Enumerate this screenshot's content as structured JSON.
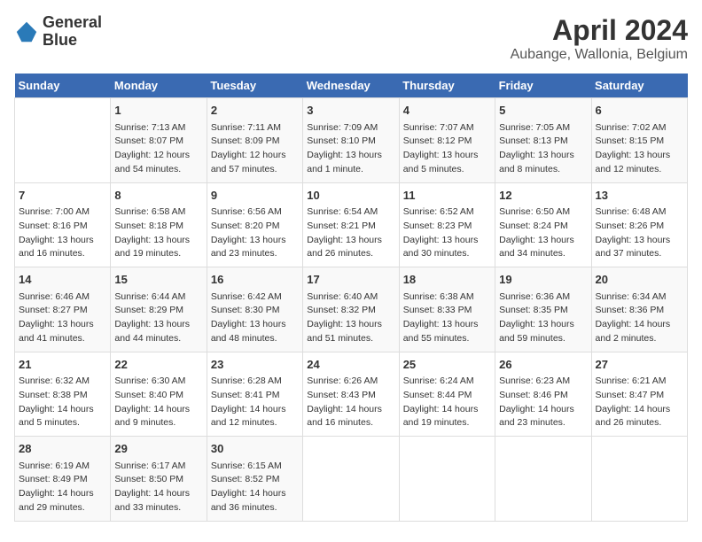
{
  "header": {
    "logo_line1": "General",
    "logo_line2": "Blue",
    "title": "April 2024",
    "subtitle": "Aubange, Wallonia, Belgium"
  },
  "columns": [
    "Sunday",
    "Monday",
    "Tuesday",
    "Wednesday",
    "Thursday",
    "Friday",
    "Saturday"
  ],
  "weeks": [
    [
      {
        "day": "",
        "info": ""
      },
      {
        "day": "1",
        "info": "Sunrise: 7:13 AM\nSunset: 8:07 PM\nDaylight: 12 hours\nand 54 minutes."
      },
      {
        "day": "2",
        "info": "Sunrise: 7:11 AM\nSunset: 8:09 PM\nDaylight: 12 hours\nand 57 minutes."
      },
      {
        "day": "3",
        "info": "Sunrise: 7:09 AM\nSunset: 8:10 PM\nDaylight: 13 hours\nand 1 minute."
      },
      {
        "day": "4",
        "info": "Sunrise: 7:07 AM\nSunset: 8:12 PM\nDaylight: 13 hours\nand 5 minutes."
      },
      {
        "day": "5",
        "info": "Sunrise: 7:05 AM\nSunset: 8:13 PM\nDaylight: 13 hours\nand 8 minutes."
      },
      {
        "day": "6",
        "info": "Sunrise: 7:02 AM\nSunset: 8:15 PM\nDaylight: 13 hours\nand 12 minutes."
      }
    ],
    [
      {
        "day": "7",
        "info": "Sunrise: 7:00 AM\nSunset: 8:16 PM\nDaylight: 13 hours\nand 16 minutes."
      },
      {
        "day": "8",
        "info": "Sunrise: 6:58 AM\nSunset: 8:18 PM\nDaylight: 13 hours\nand 19 minutes."
      },
      {
        "day": "9",
        "info": "Sunrise: 6:56 AM\nSunset: 8:20 PM\nDaylight: 13 hours\nand 23 minutes."
      },
      {
        "day": "10",
        "info": "Sunrise: 6:54 AM\nSunset: 8:21 PM\nDaylight: 13 hours\nand 26 minutes."
      },
      {
        "day": "11",
        "info": "Sunrise: 6:52 AM\nSunset: 8:23 PM\nDaylight: 13 hours\nand 30 minutes."
      },
      {
        "day": "12",
        "info": "Sunrise: 6:50 AM\nSunset: 8:24 PM\nDaylight: 13 hours\nand 34 minutes."
      },
      {
        "day": "13",
        "info": "Sunrise: 6:48 AM\nSunset: 8:26 PM\nDaylight: 13 hours\nand 37 minutes."
      }
    ],
    [
      {
        "day": "14",
        "info": "Sunrise: 6:46 AM\nSunset: 8:27 PM\nDaylight: 13 hours\nand 41 minutes."
      },
      {
        "day": "15",
        "info": "Sunrise: 6:44 AM\nSunset: 8:29 PM\nDaylight: 13 hours\nand 44 minutes."
      },
      {
        "day": "16",
        "info": "Sunrise: 6:42 AM\nSunset: 8:30 PM\nDaylight: 13 hours\nand 48 minutes."
      },
      {
        "day": "17",
        "info": "Sunrise: 6:40 AM\nSunset: 8:32 PM\nDaylight: 13 hours\nand 51 minutes."
      },
      {
        "day": "18",
        "info": "Sunrise: 6:38 AM\nSunset: 8:33 PM\nDaylight: 13 hours\nand 55 minutes."
      },
      {
        "day": "19",
        "info": "Sunrise: 6:36 AM\nSunset: 8:35 PM\nDaylight: 13 hours\nand 59 minutes."
      },
      {
        "day": "20",
        "info": "Sunrise: 6:34 AM\nSunset: 8:36 PM\nDaylight: 14 hours\nand 2 minutes."
      }
    ],
    [
      {
        "day": "21",
        "info": "Sunrise: 6:32 AM\nSunset: 8:38 PM\nDaylight: 14 hours\nand 5 minutes."
      },
      {
        "day": "22",
        "info": "Sunrise: 6:30 AM\nSunset: 8:40 PM\nDaylight: 14 hours\nand 9 minutes."
      },
      {
        "day": "23",
        "info": "Sunrise: 6:28 AM\nSunset: 8:41 PM\nDaylight: 14 hours\nand 12 minutes."
      },
      {
        "day": "24",
        "info": "Sunrise: 6:26 AM\nSunset: 8:43 PM\nDaylight: 14 hours\nand 16 minutes."
      },
      {
        "day": "25",
        "info": "Sunrise: 6:24 AM\nSunset: 8:44 PM\nDaylight: 14 hours\nand 19 minutes."
      },
      {
        "day": "26",
        "info": "Sunrise: 6:23 AM\nSunset: 8:46 PM\nDaylight: 14 hours\nand 23 minutes."
      },
      {
        "day": "27",
        "info": "Sunrise: 6:21 AM\nSunset: 8:47 PM\nDaylight: 14 hours\nand 26 minutes."
      }
    ],
    [
      {
        "day": "28",
        "info": "Sunrise: 6:19 AM\nSunset: 8:49 PM\nDaylight: 14 hours\nand 29 minutes."
      },
      {
        "day": "29",
        "info": "Sunrise: 6:17 AM\nSunset: 8:50 PM\nDaylight: 14 hours\nand 33 minutes."
      },
      {
        "day": "30",
        "info": "Sunrise: 6:15 AM\nSunset: 8:52 PM\nDaylight: 14 hours\nand 36 minutes."
      },
      {
        "day": "",
        "info": ""
      },
      {
        "day": "",
        "info": ""
      },
      {
        "day": "",
        "info": ""
      },
      {
        "day": "",
        "info": ""
      }
    ]
  ]
}
